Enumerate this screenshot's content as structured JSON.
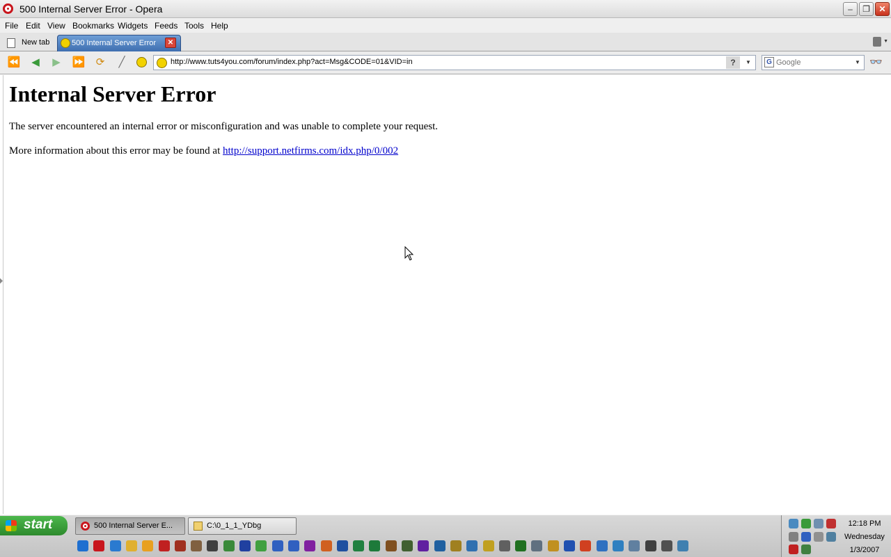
{
  "window": {
    "title": "500 Internal Server Error - Opera",
    "minimize_glyph": "–",
    "restore_glyph": "❐",
    "close_glyph": "✕"
  },
  "menu": {
    "items": [
      {
        "label": "File"
      },
      {
        "label": "Edit"
      },
      {
        "label": "View"
      },
      {
        "label": "Bookmarks"
      },
      {
        "label": "Widgets"
      },
      {
        "label": "Feeds"
      },
      {
        "label": "Tools"
      },
      {
        "label": "Help"
      }
    ]
  },
  "tabs": {
    "new_tab": "New tab",
    "active": "500 Internal Server Error"
  },
  "address": {
    "url": "http://www.tuts4you.com/forum/index.php?act=Msg&CODE=01&VID=in",
    "help_label": "?"
  },
  "search": {
    "engine_letter": "G",
    "placeholder": "Google"
  },
  "page": {
    "heading": "Internal Server Error",
    "message": "The server encountered an internal error or misconfiguration and was unable to complete your request.",
    "more_info_text": "More information about this error may be found at ",
    "more_info_link": "http://support.netfirms.com/idx.php/0/002"
  },
  "taskbar": {
    "start_label": "start",
    "tasks": [
      {
        "label": "500 Internal Server E..."
      },
      {
        "label": "C:\\0_1_1_YDbg"
      }
    ],
    "quick_launch": [
      {
        "icon": "ie-icon",
        "color": "#1e6fd0"
      },
      {
        "icon": "opera-icon",
        "color": "#c8161d"
      },
      {
        "icon": "browser-icon",
        "color": "#2a7ad0"
      },
      {
        "icon": "folder-icon",
        "color": "#e0b030"
      },
      {
        "icon": "clock-icon",
        "color": "#e8a020"
      },
      {
        "icon": "bug-icon",
        "color": "#c02020"
      },
      {
        "icon": "tool-icon",
        "color": "#a03020"
      },
      {
        "icon": "figure-icon",
        "color": "#806040"
      },
      {
        "icon": "face-icon",
        "color": "#404040"
      },
      {
        "icon": "globe-icon",
        "color": "#3a8a3a"
      },
      {
        "icon": "v-icon",
        "color": "#2040a0"
      },
      {
        "icon": "disc-icon",
        "color": "#40a040"
      },
      {
        "icon": "arrow-icon",
        "color": "#3060c0"
      },
      {
        "icon": "arrow2-icon",
        "color": "#3060c0"
      },
      {
        "icon": "grid-icon",
        "color": "#8020a0"
      },
      {
        "icon": "paint-icon",
        "color": "#d06020"
      },
      {
        "icon": "media-icon",
        "color": "#2050a0"
      },
      {
        "icon": "edit-icon",
        "color": "#208040"
      },
      {
        "icon": "excel-icon",
        "color": "#1d7a3a"
      },
      {
        "icon": "tools-icon",
        "color": "#805020"
      },
      {
        "icon": "chip-icon",
        "color": "#406030"
      },
      {
        "icon": "sw-icon",
        "color": "#6020a0"
      },
      {
        "icon": "network-icon",
        "color": "#2060a0"
      },
      {
        "icon": "book-icon",
        "color": "#a08020"
      },
      {
        "icon": "link-icon",
        "color": "#3070b0"
      },
      {
        "icon": "coin-icon",
        "color": "#c0a020"
      },
      {
        "icon": "window-icon",
        "color": "#606060"
      },
      {
        "icon": "monitor-icon",
        "color": "#207020"
      },
      {
        "icon": "gear-icon",
        "color": "#607080"
      },
      {
        "icon": "pencil-icon",
        "color": "#c09020"
      },
      {
        "icon": "w-icon",
        "color": "#2050b0"
      },
      {
        "icon": "c-icon",
        "color": "#d04020"
      },
      {
        "icon": "d-icon",
        "color": "#3070c0"
      },
      {
        "icon": "t-icon",
        "color": "#3080c0"
      },
      {
        "icon": "r-icon",
        "color": "#6080a0"
      },
      {
        "icon": "doc-icon",
        "color": "#404040"
      },
      {
        "icon": "pipe-icon",
        "color": "#505050"
      },
      {
        "icon": "screen-icon",
        "color": "#4080b0"
      }
    ]
  },
  "tray": {
    "time": "12:18 PM",
    "day": "Wednesday",
    "date": "1/3/2007"
  }
}
